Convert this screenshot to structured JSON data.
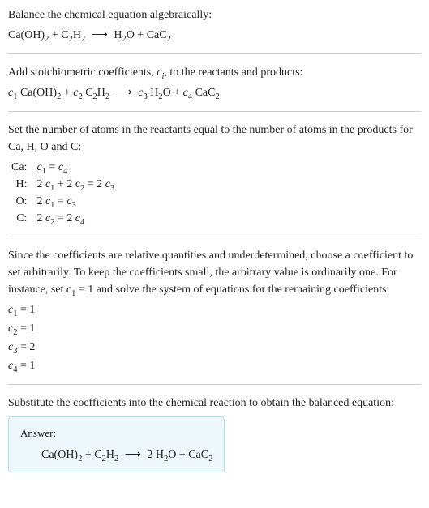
{
  "section1": {
    "title": "Balance the chemical equation algebraically:",
    "eq_lhs1": "Ca(OH)",
    "eq_lhs1_sub": "2",
    "plus": " + ",
    "eq_lhs2": "C",
    "eq_lhs2_sub": "2",
    "eq_lhs3": "H",
    "eq_lhs3_sub": "2",
    "arrow": "⟶",
    "eq_rhs1": "H",
    "eq_rhs1_sub": "2",
    "eq_rhs2": "O + CaC",
    "eq_rhs2_sub": "2"
  },
  "section2": {
    "title_a": "Add stoichiometric coefficients, ",
    "ci": "c",
    "ci_sub": "i",
    "title_b": ", to the reactants and products:",
    "c1": "c",
    "c1_sub": "1",
    "sp1": " Ca(OH)",
    "sp1_sub": "2",
    "plus1": " + ",
    "c2": "c",
    "c2_sub": "2",
    "sp2a": " C",
    "sp2a_sub": "2",
    "sp2b": "H",
    "sp2b_sub": "2",
    "arrow": "⟶",
    "c3": "c",
    "c3_sub": "3",
    "sp3a": " H",
    "sp3a_sub": "2",
    "sp3b": "O + ",
    "c4": "c",
    "c4_sub": "4",
    "sp4": " CaC",
    "sp4_sub": "2"
  },
  "section3": {
    "title": "Set the number of atoms in the reactants equal to the number of atoms in the products for Ca, H, O and C:",
    "rows": [
      {
        "el": "Ca:",
        "lhs_a": "c",
        "lhs_a_sub": "1",
        "mid": " = ",
        "rhs_a": "c",
        "rhs_a_sub": "4"
      },
      {
        "el": "H:",
        "lhs_a": "2 c",
        "lhs_a_sub": "1",
        "lhs_b": " + 2 c",
        "lhs_b_sub": "2",
        "mid": " = 2 ",
        "rhs_a": "c",
        "rhs_a_sub": "3"
      },
      {
        "el": "O:",
        "lhs_a": "2 c",
        "lhs_a_sub": "1",
        "mid": " = ",
        "rhs_a": "c",
        "rhs_a_sub": "3"
      },
      {
        "el": "C:",
        "lhs_a": "2 c",
        "lhs_a_sub": "2",
        "mid": " = 2 ",
        "rhs_a": "c",
        "rhs_a_sub": "4"
      }
    ]
  },
  "section4": {
    "p_a": "Since the coefficients are relative quantities and underdetermined, choose a coefficient to set arbitrarily. To keep the coefficients small, the arbitrary value is ordinarily one. For instance, set ",
    "c1": "c",
    "c1_sub": "1",
    "p_b": " = 1 and solve the system of equations for the remaining coefficients:",
    "lines": [
      {
        "c": "c",
        "sub": "1",
        "val": " = 1"
      },
      {
        "c": "c",
        "sub": "2",
        "val": " = 1"
      },
      {
        "c": "c",
        "sub": "3",
        "val": " = 2"
      },
      {
        "c": "c",
        "sub": "4",
        "val": " = 1"
      }
    ]
  },
  "section5": {
    "title": "Substitute the coefficients into the chemical reaction to obtain the balanced equation:",
    "answer_label": "Answer:",
    "lhs1": "Ca(OH)",
    "lhs1_sub": "2",
    "plus": " + ",
    "lhs2a": "C",
    "lhs2a_sub": "2",
    "lhs2b": "H",
    "lhs2b_sub": "2",
    "arrow": "⟶",
    "rhs_coef": " 2 ",
    "rhs1a": "H",
    "rhs1a_sub": "2",
    "rhs1b": "O + CaC",
    "rhs1b_sub": "2"
  }
}
